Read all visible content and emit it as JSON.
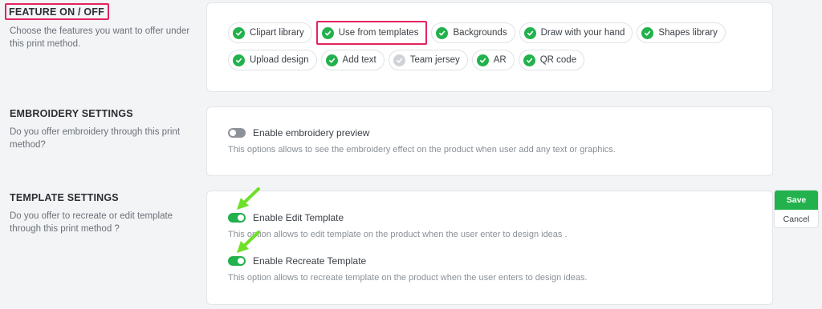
{
  "feature": {
    "title": "FEATURE ON / OFF",
    "description": "Choose the features you want to offer under this print method.",
    "chips_row1": [
      {
        "label": "Clipart library",
        "enabled": true
      },
      {
        "label": "Use from templates",
        "enabled": true
      },
      {
        "label": "Backgrounds",
        "enabled": true
      },
      {
        "label": "Draw with your hand",
        "enabled": true
      },
      {
        "label": "Shapes library",
        "enabled": true
      }
    ],
    "chips_row2": [
      {
        "label": "Upload design",
        "enabled": true
      },
      {
        "label": "Add text",
        "enabled": true
      },
      {
        "label": "Team jersey",
        "enabled": false
      },
      {
        "label": "AR",
        "enabled": true
      },
      {
        "label": "QR code",
        "enabled": true
      }
    ]
  },
  "embroidery": {
    "title": "EMBROIDERY SETTINGS",
    "description": "Do you offer embroidery through this print method?",
    "toggle_label": "Enable embroidery preview",
    "toggle_on": false,
    "help": "This options allows to see the embroidery effect on the product when user add any text or graphics."
  },
  "template": {
    "title": "TEMPLATE SETTINGS",
    "description": "Do you offer to recreate or edit template through this print method ?",
    "edit_label": "Enable Edit Template",
    "edit_on": true,
    "edit_help": "This option allows to edit template on the product when the user enter to design ideas .",
    "recreate_label": "Enable Recreate Template",
    "recreate_on": true,
    "recreate_help": "This option allows to recreate template on the product when the user enters to design ideas."
  },
  "actions": {
    "save_label": "Save",
    "cancel_label": "Cancel"
  },
  "colors": {
    "accent_green": "#22b14c",
    "highlight_pink": "#e3245e",
    "arrow_green": "#6ee02a"
  }
}
